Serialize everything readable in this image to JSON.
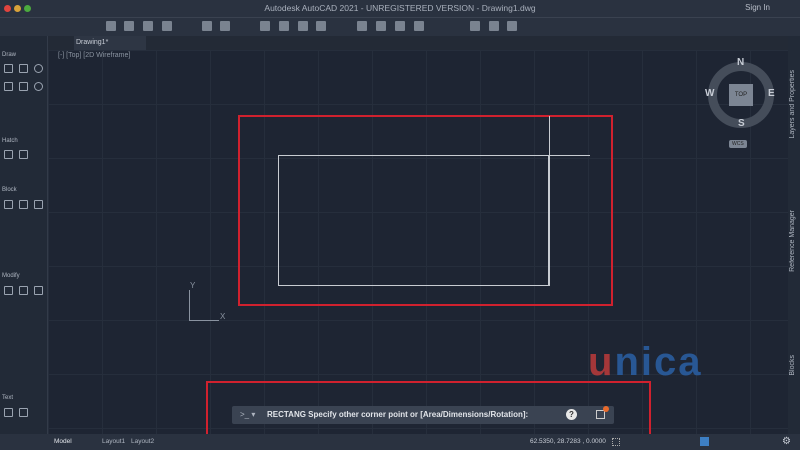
{
  "window": {
    "title": "Autodesk AutoCAD 2021 - UNREGISTERED VERSION - Drawing1.dwg",
    "sign_in": "Sign In"
  },
  "tabs": {
    "document": "Drawing1*"
  },
  "viewport": {
    "label": "[-] [Top] [2D Wireframe]"
  },
  "palette": {
    "sections": [
      "Draw",
      "Hatch",
      "Block",
      "Modify",
      "Text"
    ]
  },
  "viewcube": {
    "north": "N",
    "south": "S",
    "east": "E",
    "west": "W",
    "face": "TOP",
    "wcs": "WCS"
  },
  "ucs": {
    "x": "X",
    "y": "Y"
  },
  "right_panels": [
    "Layers and Properties",
    "Reference Manager",
    "Blocks"
  ],
  "command": {
    "prompt": ">_ ▾",
    "text": "RECTANG Specify other corner point or [Area/Dimensions/Rotation]:",
    "help": "?"
  },
  "status": {
    "tabs": [
      "Model",
      "Layout1",
      "Layout2"
    ],
    "coords": "62.5350, 28.7283 , 0.0000"
  },
  "watermark": {
    "text": "unica",
    "colors": [
      "#b33a3a",
      "#2a5d9f"
    ]
  },
  "colors": {
    "highlight": "#d0212e",
    "background": "#1e2533"
  }
}
